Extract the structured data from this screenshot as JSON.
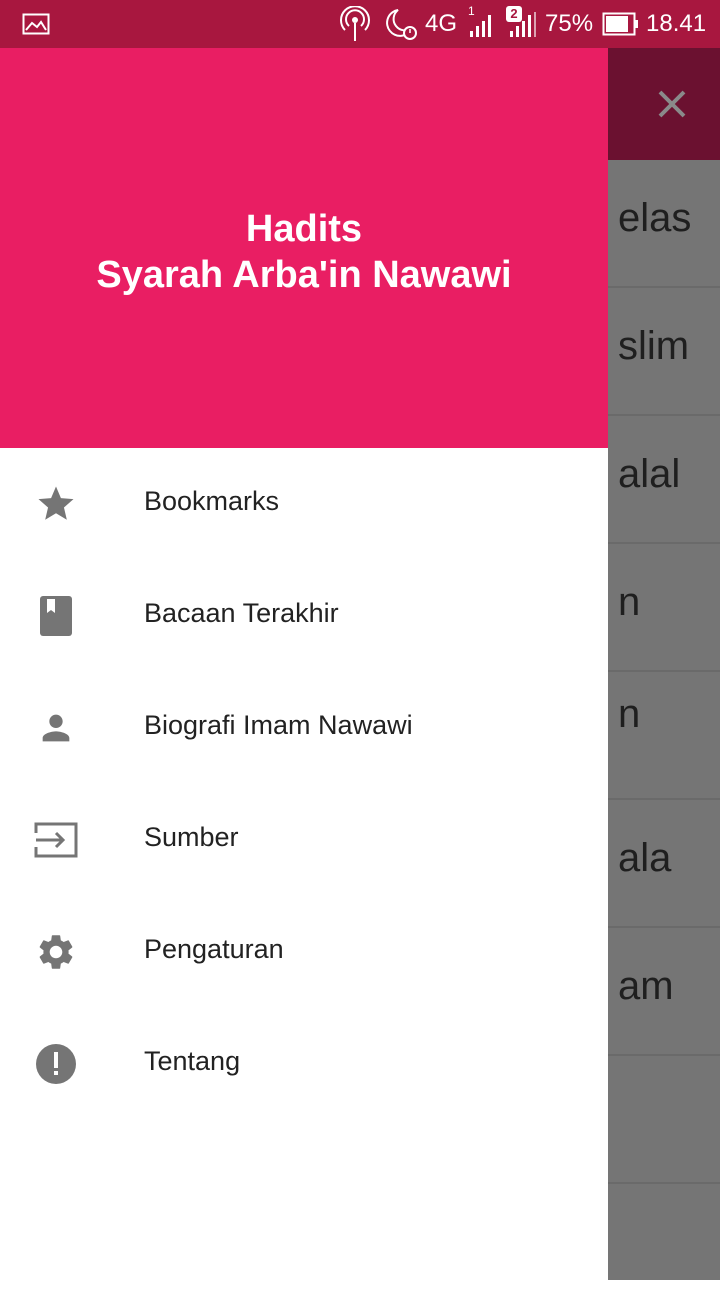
{
  "status_bar": {
    "network": "4G",
    "sim2_badge": "2",
    "sim1_badge": "1",
    "battery": "75%",
    "time": "18.41"
  },
  "drawer": {
    "title_line1": "Hadits",
    "title_line2": "Syarah Arba'in Nawawi",
    "header_color": "#e91e63",
    "items": [
      {
        "label": "Bookmarks",
        "icon": "star-icon"
      },
      {
        "label": "Bacaan Terakhir",
        "icon": "bookmark-book-icon"
      },
      {
        "label": "Biografi Imam Nawawi",
        "icon": "person-icon"
      },
      {
        "label": "Sumber",
        "icon": "input-icon"
      },
      {
        "label": "Pengaturan",
        "icon": "gear-icon"
      },
      {
        "label": "Tentang",
        "icon": "alert-icon"
      }
    ]
  },
  "background_list": {
    "rows": [
      "elas",
      "slim",
      "alal",
      "n",
      "n",
      "ala",
      "am",
      "",
      ""
    ]
  },
  "colors": {
    "status_bar": "#a8173f",
    "accent": "#e91e63",
    "scrim_appbar": "#6b1130",
    "icon": "#757575"
  }
}
